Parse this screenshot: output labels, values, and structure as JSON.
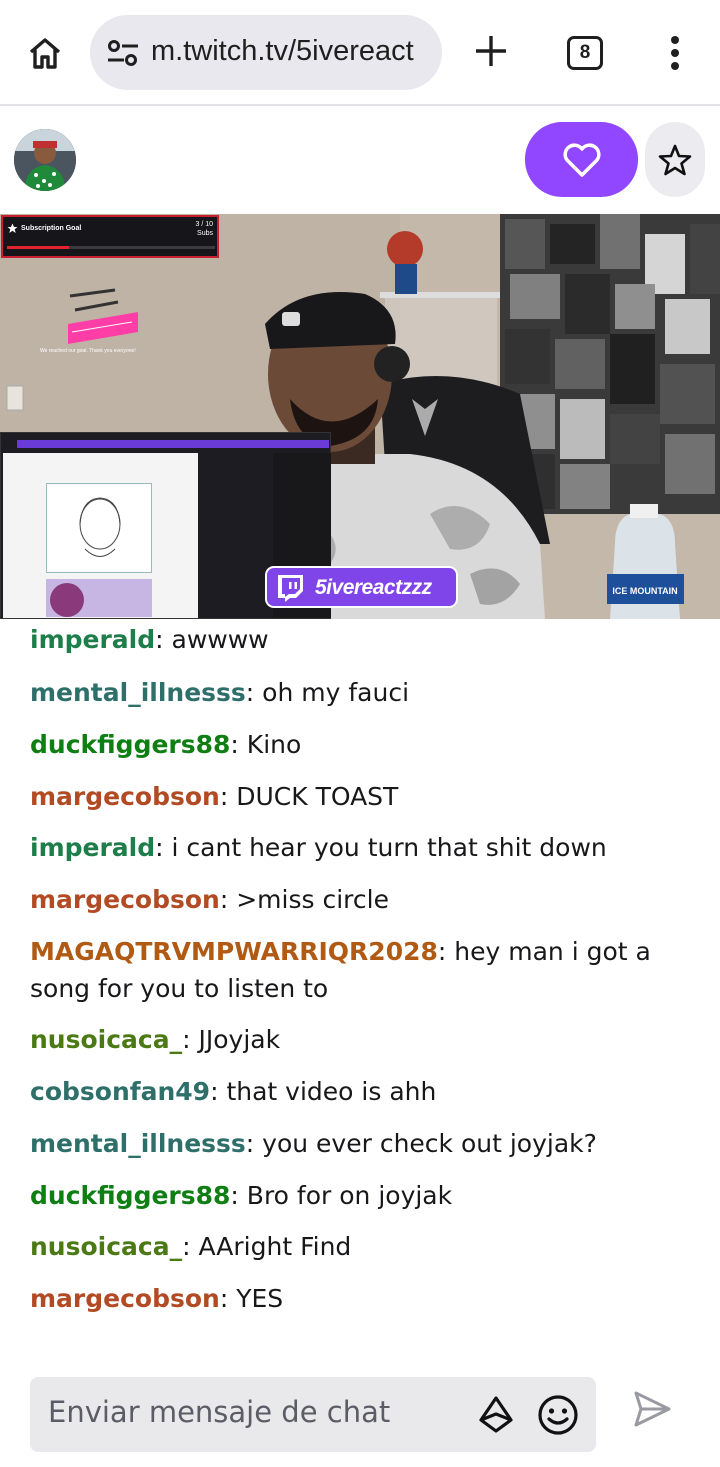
{
  "browser": {
    "url": "m.twitch.tv/5ivereact",
    "tab_count": "8",
    "icons": [
      "home-icon",
      "site-info-icon",
      "plus-icon",
      "tab-switcher-icon",
      "more-vert-icon"
    ]
  },
  "channel": {
    "follow_icon": "heart-icon",
    "favorite_icon": "star-icon",
    "accent": "#9147ff"
  },
  "video": {
    "sub_goal": {
      "title": "Subscription Goal",
      "count_line1": "3 / 10",
      "count_line2": "Subs",
      "progress": 0.3
    },
    "overlay_caption": "We reached our goal. Thank you everyone!",
    "brand_name": "5ivereactzzz"
  },
  "chat": {
    "messages": [
      {
        "user": "imperald",
        "color": "#1e7e4a",
        "text": "awwww"
      },
      {
        "user": "mental_illnesss",
        "color": "#2e6f6a",
        "text": "oh my fauci"
      },
      {
        "user": "duckfiggers88",
        "color": "#0f7f14",
        "text": "Kino"
      },
      {
        "user": "margecobson",
        "color": "#b24a24",
        "text": "DUCK TOAST"
      },
      {
        "user": "imperald",
        "color": "#1e7e4a",
        "text": "i cant hear you turn that shit down"
      },
      {
        "user": "margecobson",
        "color": "#b24a24",
        "text": ">miss circle"
      },
      {
        "user": "MAGAQTRVMPWARRIQR2028",
        "color": "#b05a14",
        "text": "hey man i got a song for you to listen to"
      },
      {
        "user": "nusoicaca_",
        "color": "#4b7a14",
        "text": "JJoyjak"
      },
      {
        "user": "cobsonfan49",
        "color": "#2e6f6a",
        "text": "that video is ahh"
      },
      {
        "user": "mental_illnesss",
        "color": "#2e6f6a",
        "text": "you ever check out joyjak?"
      },
      {
        "user": "duckfiggers88",
        "color": "#0f7f14",
        "text": "Bro for on joyjak"
      },
      {
        "user": "nusoicaca_",
        "color": "#4b7a14",
        "text": "AAright Find"
      },
      {
        "user": "margecobson",
        "color": "#b24a24",
        "text": "YES"
      }
    ],
    "input_placeholder": "Enviar mensaje de chat",
    "icons": [
      "bits-icon",
      "emote-icon",
      "send-icon"
    ]
  }
}
